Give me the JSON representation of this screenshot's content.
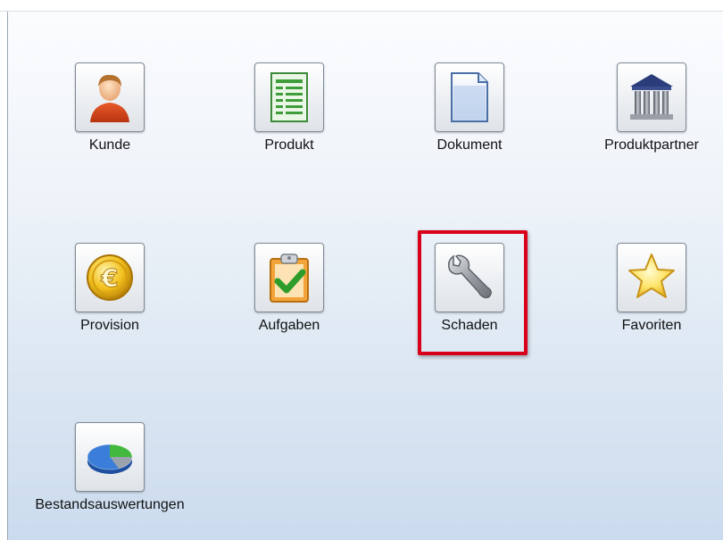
{
  "menu": {
    "items": [
      {
        "id": "kunde",
        "label": "Kunde",
        "icon": "person-icon"
      },
      {
        "id": "produkt",
        "label": "Produkt",
        "icon": "document-list-icon"
      },
      {
        "id": "dokument",
        "label": "Dokument",
        "icon": "blank-document-icon"
      },
      {
        "id": "produktpartner",
        "label": "Produktpartner",
        "icon": "institution-building-icon"
      },
      {
        "id": "provision",
        "label": "Provision",
        "icon": "euro-coin-icon"
      },
      {
        "id": "aufgaben",
        "label": "Aufgaben",
        "icon": "clipboard-check-icon"
      },
      {
        "id": "schaden",
        "label": "Schaden",
        "icon": "wrench-icon"
      },
      {
        "id": "favoriten",
        "label": "Favoriten",
        "icon": "star-icon"
      },
      {
        "id": "bestandsauswertungen",
        "label": "Bestandsauswertungen",
        "icon": "pie-chart-icon"
      }
    ],
    "highlighted": "schaden",
    "highlight_color": "#d9001b"
  }
}
